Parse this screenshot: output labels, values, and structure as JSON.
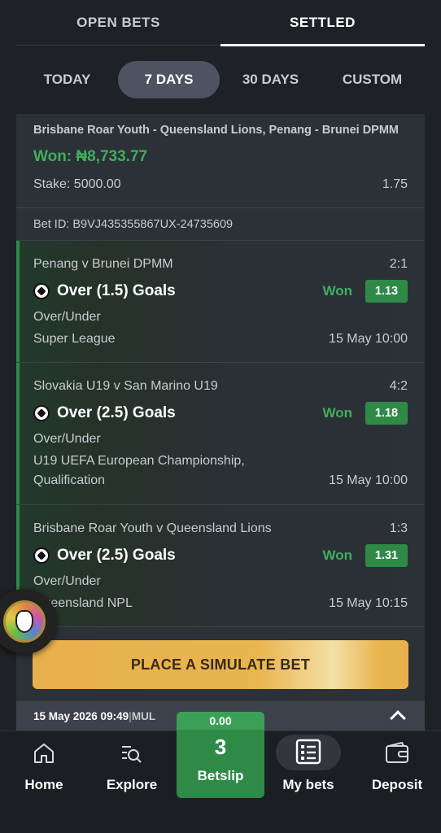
{
  "tabs": [
    {
      "label": "OPEN BETS",
      "active": false
    },
    {
      "label": "SETTLED",
      "active": true
    }
  ],
  "periods": [
    {
      "label": "TODAY",
      "active": false
    },
    {
      "label": "7 DAYS",
      "active": true
    },
    {
      "label": "30 DAYS",
      "active": false
    },
    {
      "label": "CUSTOM",
      "active": false
    }
  ],
  "bet": {
    "title": "Brisbane Roar Youth - Queensland Lions, Penang - Brunei DPMM",
    "won": "Won: ₦8,733.77",
    "stake": "Stake: 5000.00",
    "total_odds": "1.75",
    "bet_id": "Bet ID: B9VJ435355867UX-24735609",
    "legs": [
      {
        "match": "Penang v Brunei DPMM",
        "score": "2:1",
        "market": "Over (1.5) Goals",
        "status": "Won",
        "odds": "1.13",
        "type": "Over/Under",
        "league": "Super League",
        "datetime": "15 May 10:00"
      },
      {
        "match": "Slovakia U19 v San Marino U19",
        "score": "4:2",
        "market": "Over (2.5) Goals",
        "status": "Won",
        "odds": "1.18",
        "type": "Over/Under",
        "league": "U19 UEFA European Championship, Qualification",
        "datetime": "15 May 10:00"
      },
      {
        "match": "Brisbane Roar Youth v Queensland Lions",
        "score": "1:3",
        "market": "Over (2.5) Goals",
        "status": "Won",
        "odds": "1.31",
        "type": "Over/Under",
        "league": "Queensland NPL",
        "datetime": "15 May 10:15"
      }
    ]
  },
  "place_button": "PLACE A SIMULATE BET",
  "next_bet": {
    "date": "15 May 2026 09:49",
    "sep": " | ",
    "type": "MUL"
  },
  "nav": {
    "home": "Home",
    "explore": "Explore",
    "betslip_amount": "0.00",
    "betslip_count": "3",
    "betslip": "Betslip",
    "mybets": "My bets",
    "deposit": "Deposit"
  },
  "colors": {
    "accent_green": "#2f8a48",
    "won_text": "#3fae5c",
    "button_gold": "#e9b54f",
    "background": "#1e2126"
  }
}
